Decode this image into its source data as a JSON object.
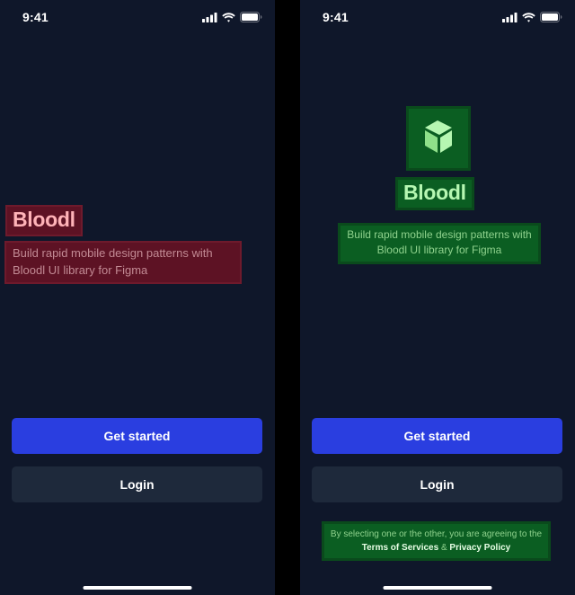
{
  "status_bar": {
    "time": "9:41",
    "icons": [
      "cellular-signal-icon",
      "wifi-icon",
      "battery-icon"
    ]
  },
  "brand": {
    "name": "Bloodl",
    "tagline": "Build rapid mobile design patterns with Bloodl UI library for Figma",
    "logo_icon": "cube-logo-icon"
  },
  "actions": {
    "primary_label": "Get started",
    "secondary_label": "Login"
  },
  "legal": {
    "prefix": "By selecting one or the other, you are agreeing to the",
    "terms_label": "Terms of Services",
    "conjunction": "&",
    "privacy_label": "Privacy Policy"
  },
  "colors": {
    "background": "#0f172a",
    "primary_button": "#2a3ee0",
    "secondary_button": "#1e293b",
    "highlight_red": "#5d1224",
    "highlight_green": "#0b5e22",
    "text": "#ffffff"
  }
}
